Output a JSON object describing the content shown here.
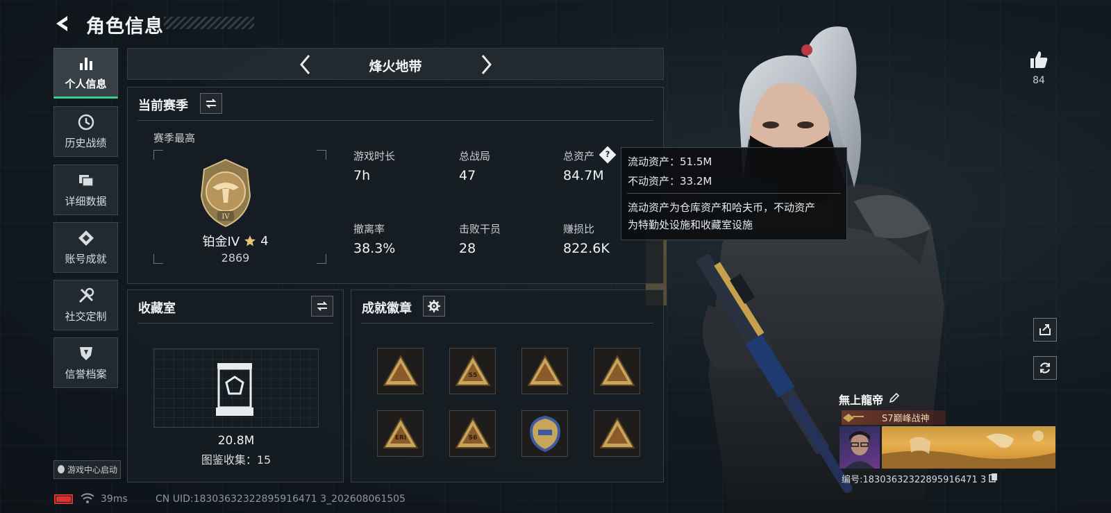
{
  "header": {
    "title": "角色信息"
  },
  "nav": [
    {
      "label": "个人信息",
      "icon": "bar-chart-icon",
      "active": true
    },
    {
      "label": "历史战绩",
      "icon": "clock-icon"
    },
    {
      "label": "详细数据",
      "icon": "folder-icon"
    },
    {
      "label": "账号成就",
      "icon": "achievement-icon"
    },
    {
      "label": "社交定制",
      "icon": "tools-icon"
    },
    {
      "label": "信誉档案",
      "icon": "shield-icon"
    }
  ],
  "game_center": {
    "label": "游戏中心启动"
  },
  "mode": {
    "title": "烽火地带"
  },
  "season": {
    "title": "当前赛季",
    "best_label": "赛季最高",
    "rank_name": "铂金IV",
    "rank_roman": "IV",
    "rank_stars": "4",
    "rank_points": "2869",
    "stats": [
      {
        "label": "游戏时长",
        "value": "7h"
      },
      {
        "label": "总战局",
        "value": "47"
      },
      {
        "label": "总资产",
        "value": "84.7M"
      },
      {
        "label": "撤离率",
        "value": "38.3%"
      },
      {
        "label": "击败干员",
        "value": "28"
      },
      {
        "label": "赚损比",
        "value": "822.6K"
      }
    ]
  },
  "tooltip": {
    "liquid": "流动资产：51.5M",
    "fixed": "不动资产：33.2M",
    "desc_line1": "流动资产为仓库资产和哈夫币，不动资产",
    "desc_line2": "为特勤处设施和收藏室设施"
  },
  "collection": {
    "title": "收藏室",
    "value": "20.8M",
    "catalog": "图鉴收集：15"
  },
  "badges": {
    "title": "成就徽章",
    "items": [
      {
        "icon": "rifle-badge-icon",
        "text": ""
      },
      {
        "icon": "vest-badge-icon",
        "text": "S5"
      },
      {
        "icon": "vehicle-badge-icon",
        "text": ""
      },
      {
        "icon": "helmet-badge-icon",
        "text": ""
      },
      {
        "icon": "eri-badge-icon",
        "text": "ERI"
      },
      {
        "icon": "s6-badge-icon",
        "text": "S6"
      },
      {
        "icon": "emblem-badge-icon",
        "text": ""
      },
      {
        "icon": "document-badge-icon",
        "text": ""
      }
    ]
  },
  "likes": {
    "count": "84"
  },
  "player": {
    "name": "無上龍帝",
    "title": "S7巅峰战神",
    "id_text": "编号:18303632322895916471 3"
  },
  "footer": {
    "ping": "39ms",
    "uid": "CN UID:18303632322895916471 3_202608061505"
  },
  "colors": {
    "accent": "#39d08e",
    "gold": "#c9a55a",
    "battery": "#e03030"
  }
}
